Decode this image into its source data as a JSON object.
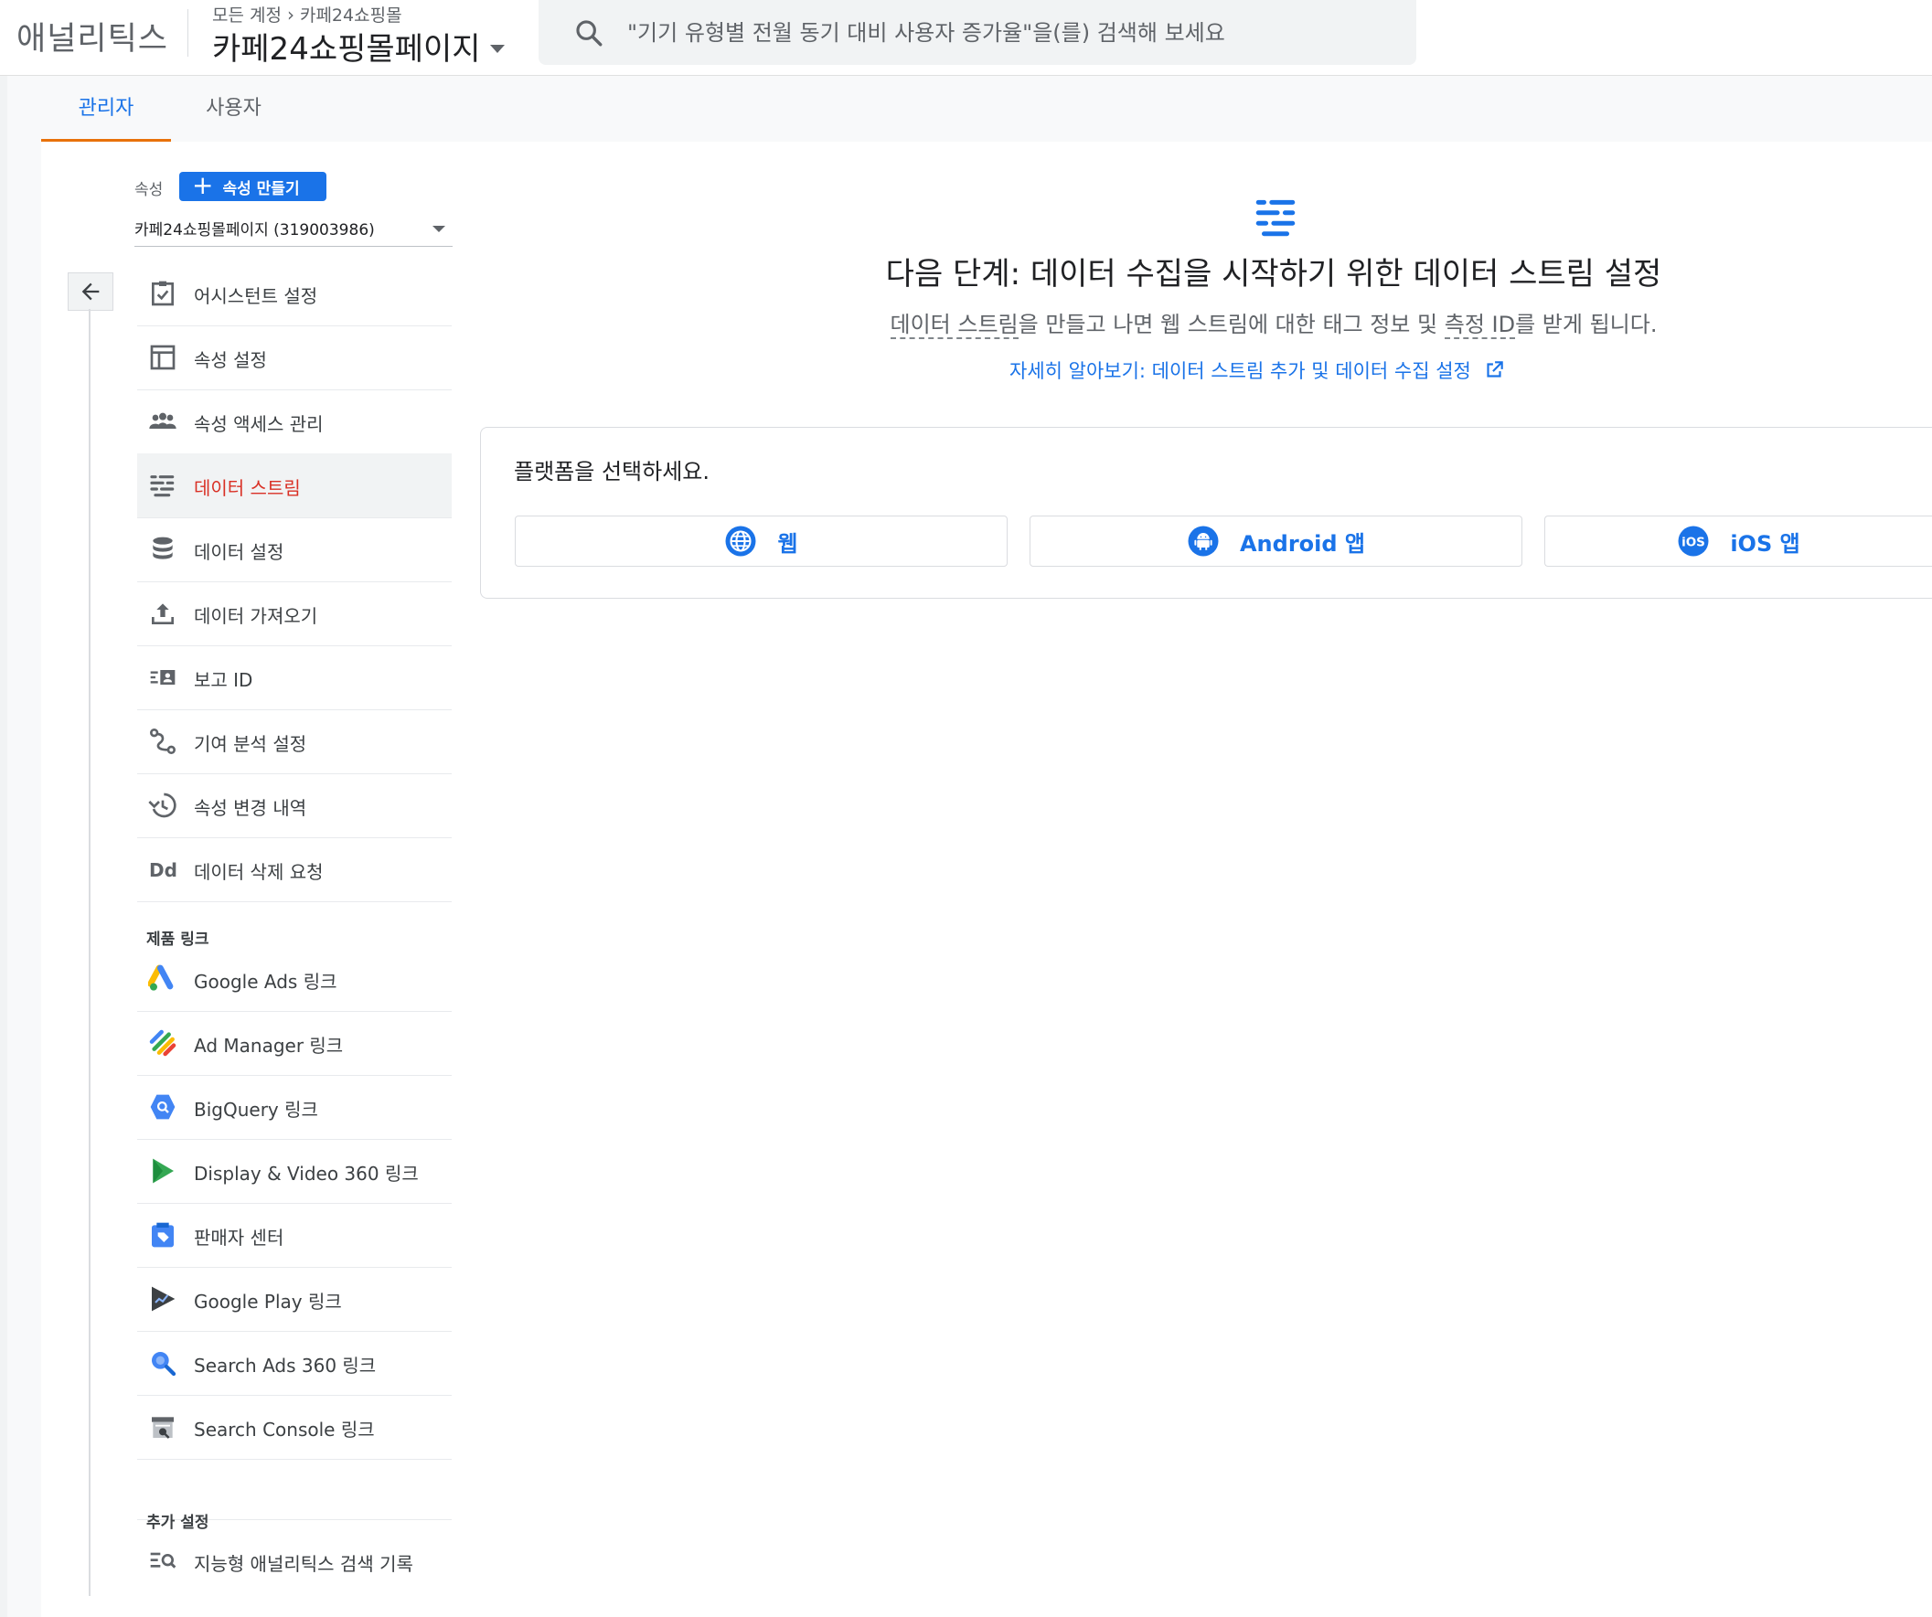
{
  "header": {
    "brand": "애널리틱스",
    "breadcrumb": [
      "모든 계정",
      "카페24쇼핑몰"
    ],
    "account_name": "카페24쇼핑몰페이지",
    "search_placeholder": "\"기기 유형별 전월 동기 대비 사용자 증가율\"을(를) 검색해 보세요"
  },
  "tabs": [
    {
      "label": "관리자",
      "active": true
    },
    {
      "label": "사용자",
      "active": false
    }
  ],
  "property": {
    "label": "속성",
    "create_button": "속성 만들기",
    "selected": "카페24쇼핑몰페이지 (319003986)"
  },
  "nav": {
    "items": [
      {
        "label": "어시스턴트 설정",
        "icon": "checklist-icon"
      },
      {
        "label": "속성 설정",
        "icon": "layout-icon"
      },
      {
        "label": "속성 액세스 관리",
        "icon": "people-icon"
      },
      {
        "label": "데이터 스트림",
        "icon": "streams-icon",
        "active": true
      },
      {
        "label": "데이터 설정",
        "icon": "database-icon"
      },
      {
        "label": "데이터 가져오기",
        "icon": "upload-icon"
      },
      {
        "label": "보고 ID",
        "icon": "reporting-id-icon"
      },
      {
        "label": "기여 분석 설정",
        "icon": "attribution-icon"
      },
      {
        "label": "속성 변경 내역",
        "icon": "history-icon"
      },
      {
        "label": "데이터 삭제 요청",
        "icon": "data-deletion-icon"
      }
    ],
    "product_links_title": "제품 링크",
    "product_links": [
      {
        "label": "Google Ads 링크",
        "icon": "google-ads-icon"
      },
      {
        "label": "Ad Manager 링크",
        "icon": "ad-manager-icon"
      },
      {
        "label": "BigQuery 링크",
        "icon": "bigquery-icon"
      },
      {
        "label": "Display & Video 360 링크",
        "icon": "display-video-icon"
      },
      {
        "label": "판매자 센터",
        "icon": "merchant-center-icon"
      },
      {
        "label": "Google Play 링크",
        "icon": "google-play-icon"
      },
      {
        "label": "Search Ads 360 링크",
        "icon": "search-ads-icon"
      },
      {
        "label": "Search Console 링크",
        "icon": "search-console-icon"
      }
    ],
    "additional_title": "추가 설정",
    "additional": [
      {
        "label": "지능형 애널리틱스 검색 기록",
        "icon": "search-history-icon"
      }
    ]
  },
  "main": {
    "title": "다음 단계: 데이터 수집을 시작하기 위한 데이터 스트림 설정",
    "subtitle_parts": [
      "데이터 스트림",
      "을 만들고 나면 웹 스트림에 대한 태그 정보 및 ",
      "측정 ID",
      "를 받게 됩니다."
    ],
    "learn_more": "자세히 알아보기: 데이터 스트림 추가 및 데이터 수집 설정",
    "platform_title": "플랫폼을 선택하세요.",
    "platforms": [
      {
        "label": "웹",
        "icon": "globe-icon"
      },
      {
        "label": "Android 앱",
        "icon": "android-icon"
      },
      {
        "label": "iOS 앱",
        "icon": "ios-icon"
      }
    ]
  },
  "colors": {
    "accent": "#1a73e8",
    "active_nav": "#d93025",
    "tab_indicator": "#e8710a"
  }
}
